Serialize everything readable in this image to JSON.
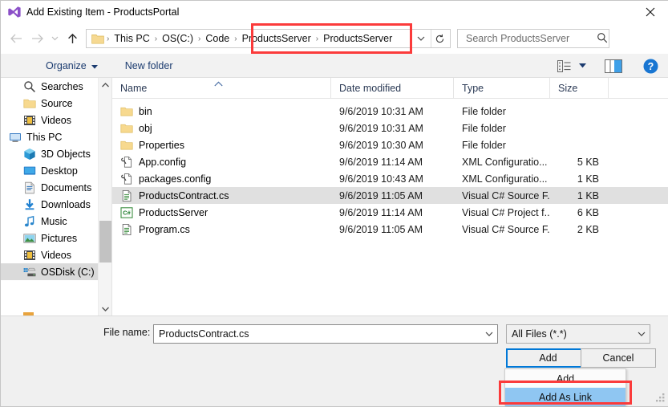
{
  "window": {
    "title": "Add Existing Item - ProductsPortal",
    "app_icon": "visual-studio-icon",
    "close_label": "✕"
  },
  "nav": {
    "back_icon": "arrow-left-icon",
    "forward_icon": "arrow-right-icon",
    "recent_icon": "chevron-down-icon",
    "up_icon": "arrow-up-icon",
    "breadcrumbs": [
      "This PC",
      "OS(C:)",
      "Code",
      "ProductsServer",
      "ProductsServer"
    ],
    "separator": "›",
    "dropdown_icon": "chevron-down-icon",
    "refresh_icon": "refresh-icon"
  },
  "search": {
    "placeholder": "Search ProductsServer",
    "value": "",
    "icon": "search-icon"
  },
  "commandbar": {
    "organize_label": "Organize",
    "organize_caret": "▾",
    "new_folder_label": "New folder",
    "view_icon": "list-view-icon",
    "view_caret": "▾",
    "preview_icon": "preview-pane-icon",
    "help_icon": "help-icon"
  },
  "sidebar": {
    "items": [
      {
        "label": "Searches",
        "icon": "search-folder-icon",
        "level": 1,
        "selected": false
      },
      {
        "label": "Source",
        "icon": "folder-icon",
        "level": 1,
        "selected": false
      },
      {
        "label": "Videos",
        "icon": "videos-icon",
        "level": 1,
        "selected": false
      },
      {
        "label": "This PC",
        "icon": "this-pc-icon",
        "level": 0,
        "selected": false
      },
      {
        "label": "3D Objects",
        "icon": "3d-objects-icon",
        "level": 1,
        "selected": false
      },
      {
        "label": "Desktop",
        "icon": "desktop-icon",
        "level": 1,
        "selected": false
      },
      {
        "label": "Documents",
        "icon": "documents-icon",
        "level": 1,
        "selected": false
      },
      {
        "label": "Downloads",
        "icon": "downloads-icon",
        "level": 1,
        "selected": false
      },
      {
        "label": "Music",
        "icon": "music-icon",
        "level": 1,
        "selected": false
      },
      {
        "label": "Pictures",
        "icon": "pictures-icon",
        "level": 1,
        "selected": false
      },
      {
        "label": "Videos",
        "icon": "videos-icon",
        "level": 1,
        "selected": false
      },
      {
        "label": "OSDisk (C:)",
        "icon": "disk-icon",
        "level": 1,
        "selected": true
      }
    ],
    "scroll_up_icon": "chevron-up-icon",
    "scroll_down_icon": "chevron-down-icon"
  },
  "filelist": {
    "columns": [
      "Name",
      "Date modified",
      "Type",
      "Size"
    ],
    "sort_indicator": "^",
    "rows": [
      {
        "name": "bin",
        "date": "9/6/2019 10:31 AM",
        "type": "File folder",
        "size": "",
        "icon": "folder-icon",
        "selected": false
      },
      {
        "name": "obj",
        "date": "9/6/2019 10:31 AM",
        "type": "File folder",
        "size": "",
        "icon": "folder-icon",
        "selected": false
      },
      {
        "name": "Properties",
        "date": "9/6/2019 10:30 AM",
        "type": "File folder",
        "size": "",
        "icon": "folder-icon",
        "selected": false
      },
      {
        "name": "App.config",
        "date": "9/6/2019 11:14 AM",
        "type": "XML Configuratio...",
        "size": "5 KB",
        "icon": "config-file-icon",
        "selected": false
      },
      {
        "name": "packages.config",
        "date": "9/6/2019 10:43 AM",
        "type": "XML Configuratio...",
        "size": "1 KB",
        "icon": "config-file-icon",
        "selected": false
      },
      {
        "name": "ProductsContract.cs",
        "date": "9/6/2019 11:05 AM",
        "type": "Visual C# Source F...",
        "size": "1 KB",
        "icon": "cs-file-icon",
        "selected": true
      },
      {
        "name": "ProductsServer",
        "date": "9/6/2019 11:14 AM",
        "type": "Visual C# Project f...",
        "size": "6 KB",
        "icon": "csproj-icon",
        "selected": false
      },
      {
        "name": "Program.cs",
        "date": "9/6/2019 11:05 AM",
        "type": "Visual C# Source F...",
        "size": "2 KB",
        "icon": "cs-file-icon",
        "selected": false
      }
    ]
  },
  "footer": {
    "filename_label": "File name:",
    "filename_value": "ProductsContract.cs",
    "filename_dropdown_icon": "chevron-down-icon",
    "filter_value": "All Files (*.*)",
    "filter_dropdown_icon": "chevron-down-icon",
    "add_label": "Add",
    "add_split_icon": "caret-down-icon",
    "cancel_label": "Cancel",
    "resize_grip_icon": "resize-grip-icon"
  },
  "dropdown_menu": {
    "items": [
      {
        "label": "Add",
        "highlighted": false
      },
      {
        "label": "Add As Link",
        "highlighted": true
      }
    ]
  },
  "annotations": {
    "breadcrumb_highlight_color": "#fb3b3b",
    "menu_highlight_color": "#fb3b3b",
    "selection_color": "#8fc6f2",
    "accent_color": "#0078d7"
  }
}
